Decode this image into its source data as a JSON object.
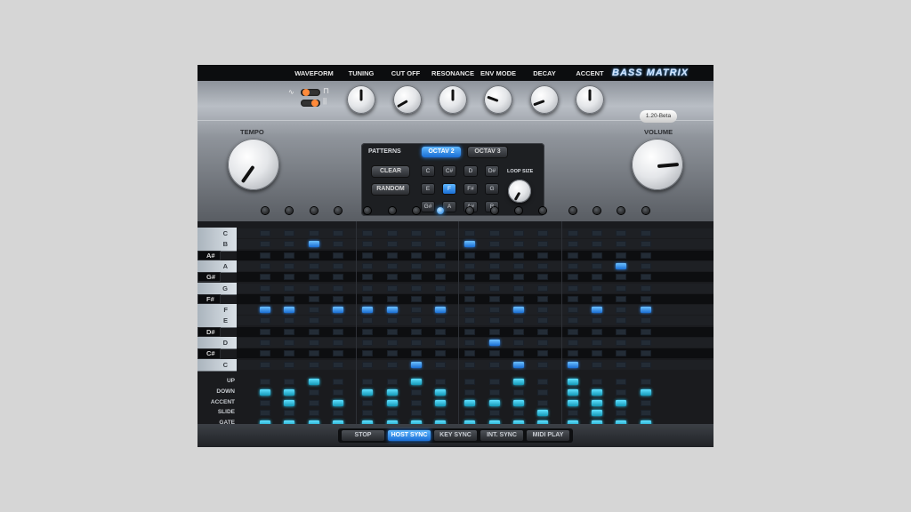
{
  "title": "BASS MATRIX",
  "version": "1.20-Beta",
  "params": [
    "WAVEFORM",
    "TUNING",
    "CUT OFF",
    "RESONANCE",
    "ENV MODE",
    "DECAY",
    "ACCENT"
  ],
  "tempo_label": "TEMPO",
  "volume_label": "VOLUME",
  "patterns": {
    "title": "PATTERNS",
    "octave_buttons": [
      "OCTAV 2",
      "OCTAV 3"
    ],
    "clear": "CLEAR",
    "random": "RANDOM",
    "loop_size_label": "LOOP SIZE",
    "notes": [
      "C",
      "C#",
      "D",
      "D#",
      "E",
      "F",
      "F#",
      "G",
      "G#",
      "A",
      "A#",
      "B"
    ],
    "selected_note": "F"
  },
  "keys": [
    {
      "label": "C",
      "color": "white"
    },
    {
      "label": "B",
      "color": "white"
    },
    {
      "label": "A#",
      "color": "black"
    },
    {
      "label": "A",
      "color": "white"
    },
    {
      "label": "G#",
      "color": "black"
    },
    {
      "label": "G",
      "color": "white"
    },
    {
      "label": "F#",
      "color": "black"
    },
    {
      "label": "F",
      "color": "white"
    },
    {
      "label": "E",
      "color": "white"
    },
    {
      "label": "D#",
      "color": "black"
    },
    {
      "label": "D",
      "color": "white"
    },
    {
      "label": "C#",
      "color": "black"
    },
    {
      "label": "C",
      "color": "white"
    }
  ],
  "step_rows": [
    "UP",
    "DOWN",
    "ACCENT",
    "SLIDE",
    "GATE"
  ],
  "steps": 16,
  "active_step": 8,
  "note_grid": {
    "B": [
      3,
      9
    ],
    "A": [
      15
    ],
    "F": [
      1,
      2,
      4,
      5,
      6,
      8,
      11,
      14,
      16
    ],
    "D": [
      10
    ],
    "C": [
      7,
      11,
      13
    ]
  },
  "step_grid": {
    "UP": [
      3,
      7,
      11,
      13
    ],
    "DOWN": [
      1,
      2,
      5,
      6,
      8,
      13,
      14,
      16
    ],
    "ACCENT": [
      2,
      4,
      6,
      8,
      9,
      10,
      11,
      13,
      14,
      15
    ],
    "SLIDE": [
      12,
      14
    ],
    "GATE": [
      1,
      2,
      3,
      4,
      5,
      6,
      7,
      8,
      9,
      10,
      11,
      12,
      13,
      14,
      15,
      16
    ]
  },
  "modes": [
    "STOP",
    "HOST SYNC",
    "KEY SYNC",
    "INT. SYNC",
    "MIDI PLAY"
  ],
  "active_mode": "HOST SYNC"
}
